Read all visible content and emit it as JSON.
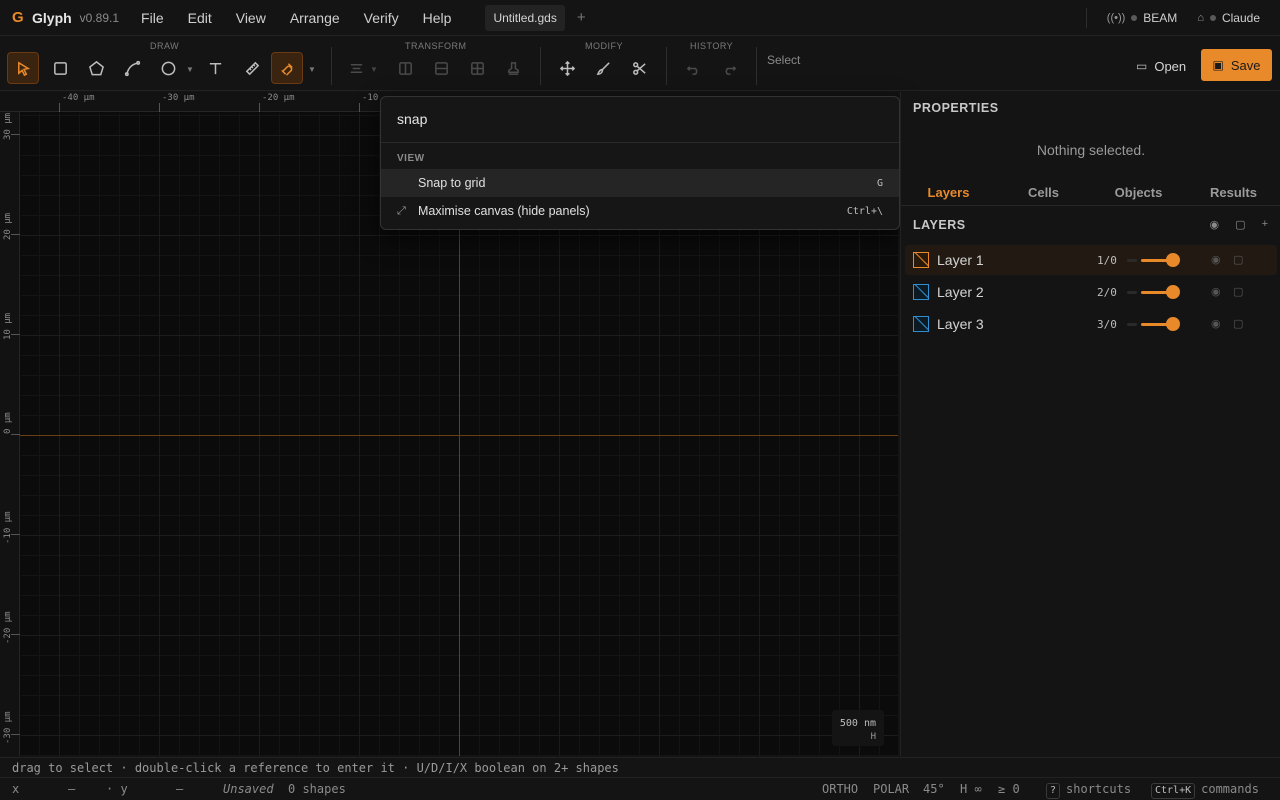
{
  "app": {
    "logo_glyph": "G",
    "name": "Glyph",
    "version": "v0.89.1"
  },
  "menu": [
    "File",
    "Edit",
    "View",
    "Arrange",
    "Verify",
    "Help"
  ],
  "tabs": {
    "file": "Untitled.gds",
    "add": "+"
  },
  "header_right": {
    "beam": "BEAM",
    "assistant": "Claude"
  },
  "toolbar": {
    "groups": {
      "draw": "DRAW",
      "transform": "TRANSFORM",
      "modify": "MODIFY",
      "history": "HISTORY"
    },
    "status": "Select",
    "open_label": "Open",
    "save_label": "Save"
  },
  "rulers": {
    "top": [
      "-40 µm",
      "-30 µm",
      "-20 µm",
      "-10"
    ],
    "left": [
      "30 µm",
      "20 µm",
      "10 µm",
      "0 µm",
      "-10 µm",
      "-20 µm",
      "-30 µm"
    ]
  },
  "scale": {
    "value": "500 nm",
    "sub": "H"
  },
  "palette": {
    "query": "snap",
    "section": "VIEW",
    "items": [
      {
        "label": "Snap to grid",
        "shortcut": "G",
        "icon": "grid-icon"
      },
      {
        "label": "Maximise canvas (hide panels)",
        "shortcut": "Ctrl+\\",
        "icon": "expand-icon"
      }
    ]
  },
  "properties": {
    "title": "PROPERTIES",
    "empty": "Nothing selected."
  },
  "panel_tabs": [
    "Layers",
    "Cells",
    "Objects",
    "Results"
  ],
  "layers": {
    "title": "LAYERS",
    "items": [
      {
        "name": "Layer 1",
        "gds": "1/0",
        "color": "#e8892a",
        "opacity": 1.0
      },
      {
        "name": "Layer 2",
        "gds": "2/0",
        "color": "#2f8fd0",
        "opacity": 1.0
      },
      {
        "name": "Layer 3",
        "gds": "3/0",
        "color": "#2f8fd0",
        "opacity": 1.0
      }
    ]
  },
  "hint": "drag to select · double-click a reference to enter it · U/D/I/X boolean on 2+ shapes",
  "status": {
    "x_label": "x",
    "x_val": "—",
    "y_label": "· y",
    "y_val": "—",
    "unsaved": "Unsaved",
    "shapes": "0 shapes",
    "ortho": "ORTHO",
    "polar": "POLAR",
    "angle": "45°",
    "h": "H ∞",
    "ge": "≥ 0",
    "shortcuts_key": "?",
    "shortcuts": "shortcuts",
    "commands_key": "Ctrl+K",
    "commands": "commands"
  },
  "colors": {
    "accent": "#e8892a",
    "bg": "#141414",
    "canvas": "#0b0b0b"
  }
}
